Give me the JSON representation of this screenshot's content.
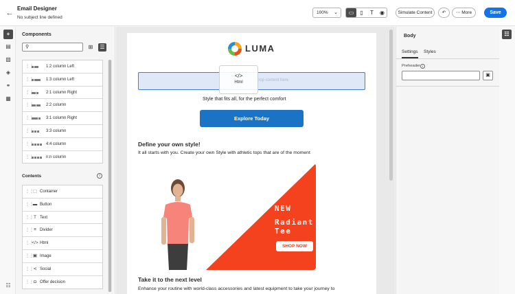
{
  "header": {
    "title": "Email Designer",
    "subtitle": "No subject line defined",
    "zoom": "100%",
    "simulate_label": "Simulate Content",
    "more_label": "More",
    "save_label": "Save"
  },
  "view_modes": [
    "desktop-icon",
    "mobile-icon",
    "text-icon",
    "preview-icon"
  ],
  "left_rail": [
    "add-icon",
    "fragments-icon",
    "assets-icon",
    "layers-icon",
    "links-icon",
    "personalization-icon",
    "help-icon"
  ],
  "components_panel": {
    "title": "Components",
    "search_placeholder": "",
    "structures": [
      {
        "label": "1:2 column Left",
        "bars": [
          1,
          2
        ]
      },
      {
        "label": "1:3 column Left",
        "bars": [
          1,
          3
        ]
      },
      {
        "label": "2:1 column Right",
        "bars": [
          2,
          1
        ]
      },
      {
        "label": "2:2 column",
        "bars": [
          2,
          2
        ]
      },
      {
        "label": "3:1 column Right",
        "bars": [
          3,
          1
        ]
      },
      {
        "label": "3:3 column",
        "bars": [
          1,
          1,
          1
        ]
      },
      {
        "label": "4:4 column",
        "bars": [
          1,
          1,
          1,
          1
        ]
      },
      {
        "label": "n:n column",
        "bars": [
          1,
          1,
          1,
          1
        ]
      }
    ],
    "contents_title": "Contents",
    "contents": [
      {
        "label": "Container",
        "icon": "container-icon",
        "glyph": "⬚"
      },
      {
        "label": "Button",
        "icon": "button-icon",
        "glyph": "▬"
      },
      {
        "label": "Text",
        "icon": "text-icon",
        "glyph": "T"
      },
      {
        "label": "Divider",
        "icon": "divider-icon",
        "glyph": "≡"
      },
      {
        "label": "Html",
        "icon": "html-icon",
        "glyph": "</>"
      },
      {
        "label": "Image",
        "icon": "image-icon",
        "glyph": "▣"
      },
      {
        "label": "Social",
        "icon": "social-icon",
        "glyph": "⋖"
      },
      {
        "label": "Offer decision",
        "icon": "offer-decision-icon",
        "glyph": "◘"
      }
    ]
  },
  "email": {
    "brand": "LUMA",
    "placeholder_text": "Drop content here",
    "drag_label": "Html",
    "tagline": "Style that fits all, for the perfect comfort",
    "cta": "Explore Today",
    "heading1": "Define your own style!",
    "para1": "It all starts with you. Create your own Style with athletic tops that are of the moment",
    "banner": {
      "line1": "NEW",
      "line2": "Radiant",
      "line3": "Tee",
      "cta": "SHOP NOW",
      "color": "#f4421e"
    },
    "heading2": "Take it to the next level",
    "para2": "Enhance your routine with world-class accessories and latest equipment to take your journey to"
  },
  "right_panel": {
    "title": "Body",
    "tabs": [
      "Settings",
      "Styles"
    ],
    "preheader_label": "Preheader",
    "preheader_value": ""
  },
  "colors": {
    "accent": "#1473e6",
    "cta": "#1a73c5",
    "selection": "#3e7cd6"
  }
}
